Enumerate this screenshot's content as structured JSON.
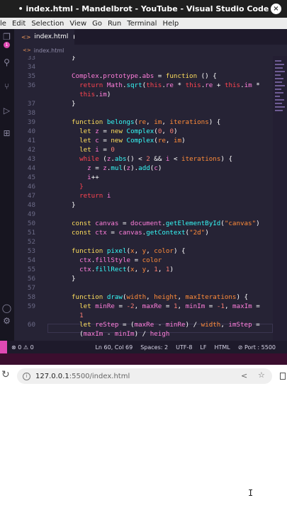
{
  "window": {
    "title": "• index.html - Mandelbrot - YouTube - Visual Studio Code",
    "close_glyph": "×"
  },
  "menu": [
    "le",
    "Edit",
    "Selection",
    "View",
    "Go",
    "Run",
    "Terminal",
    "Help"
  ],
  "activity": {
    "badge": "1"
  },
  "tab": {
    "label": "index.html"
  },
  "breadcrumb": {
    "file": "index.html"
  },
  "code_lines": [
    {
      "n": "33",
      "t": [
        [
          "w",
          "}"
        ]
      ]
    },
    {
      "n": "34",
      "t": []
    },
    {
      "n": "35",
      "t": [
        [
          "c",
          "Complex"
        ],
        [
          "w",
          "."
        ],
        [
          "c",
          "prototype"
        ],
        [
          "w",
          "."
        ],
        [
          "c",
          "abs"
        ],
        [
          "w",
          " = "
        ],
        [
          "k",
          "function"
        ],
        [
          "w",
          " () {"
        ]
      ]
    },
    {
      "n": "36",
      "t": [
        [
          "w",
          "  "
        ],
        [
          "p",
          "return"
        ],
        [
          "w",
          " "
        ],
        [
          "c",
          "Math"
        ],
        [
          "w",
          "."
        ],
        [
          "f",
          "sqrt"
        ],
        [
          "w",
          "("
        ],
        [
          "p",
          "this"
        ],
        [
          "w",
          "."
        ],
        [
          "c",
          "re"
        ],
        [
          "w",
          " * "
        ],
        [
          "p",
          "this"
        ],
        [
          "w",
          "."
        ],
        [
          "c",
          "re"
        ],
        [
          "w",
          " + "
        ],
        [
          "p",
          "this"
        ],
        [
          "w",
          "."
        ],
        [
          "c",
          "im"
        ],
        [
          "w",
          " *"
        ]
      ]
    },
    {
      "n": "",
      "t": [
        [
          "w",
          "  "
        ],
        [
          "p",
          "this"
        ],
        [
          "w",
          "."
        ],
        [
          "c",
          "im"
        ],
        [
          "w",
          ")"
        ]
      ]
    },
    {
      "n": "37",
      "t": [
        [
          "w",
          "}"
        ]
      ]
    },
    {
      "n": "38",
      "t": []
    },
    {
      "n": "39",
      "t": [
        [
          "k",
          "function"
        ],
        [
          "w",
          " "
        ],
        [
          "f",
          "belongs"
        ],
        [
          "w",
          "("
        ],
        [
          "s",
          "re"
        ],
        [
          "w",
          ", "
        ],
        [
          "s",
          "im"
        ],
        [
          "w",
          ", "
        ],
        [
          "s",
          "iterations"
        ],
        [
          "w",
          ") {"
        ]
      ]
    },
    {
      "n": "40",
      "t": [
        [
          "w",
          "  "
        ],
        [
          "k",
          "let"
        ],
        [
          "w",
          " "
        ],
        [
          "c",
          "z"
        ],
        [
          "w",
          " = "
        ],
        [
          "k",
          "new"
        ],
        [
          "w",
          " "
        ],
        [
          "f",
          "Complex"
        ],
        [
          "w",
          "("
        ],
        [
          "n",
          "0"
        ],
        [
          "w",
          ", "
        ],
        [
          "n",
          "0"
        ],
        [
          "w",
          ")"
        ]
      ]
    },
    {
      "n": "41",
      "t": [
        [
          "w",
          "  "
        ],
        [
          "k",
          "let"
        ],
        [
          "w",
          " "
        ],
        [
          "c",
          "c"
        ],
        [
          "w",
          " = "
        ],
        [
          "k",
          "new"
        ],
        [
          "w",
          " "
        ],
        [
          "f",
          "Complex"
        ],
        [
          "w",
          "("
        ],
        [
          "s",
          "re"
        ],
        [
          "w",
          ", "
        ],
        [
          "s",
          "im"
        ],
        [
          "w",
          ")"
        ]
      ]
    },
    {
      "n": "42",
      "t": [
        [
          "w",
          "  "
        ],
        [
          "k",
          "let"
        ],
        [
          "w",
          " "
        ],
        [
          "c",
          "i"
        ],
        [
          "w",
          " = "
        ],
        [
          "n",
          "0"
        ]
      ]
    },
    {
      "n": "43",
      "t": [
        [
          "w",
          "  "
        ],
        [
          "p",
          "while"
        ],
        [
          "w",
          " ("
        ],
        [
          "c",
          "z"
        ],
        [
          "w",
          "."
        ],
        [
          "f",
          "abs"
        ],
        [
          "w",
          "() < "
        ],
        [
          "n",
          "2"
        ],
        [
          "w",
          " && "
        ],
        [
          "c",
          "i"
        ],
        [
          "w",
          " < "
        ],
        [
          "s",
          "iterations"
        ],
        [
          "w",
          ") {"
        ]
      ]
    },
    {
      "n": "44",
      "t": [
        [
          "w",
          "    "
        ],
        [
          "c",
          "z"
        ],
        [
          "w",
          " = "
        ],
        [
          "c",
          "z"
        ],
        [
          "w",
          "."
        ],
        [
          "f",
          "mul"
        ],
        [
          "w",
          "("
        ],
        [
          "c",
          "z"
        ],
        [
          "w",
          ")."
        ],
        [
          "f",
          "add"
        ],
        [
          "w",
          "("
        ],
        [
          "c",
          "c"
        ],
        [
          "w",
          ")"
        ]
      ]
    },
    {
      "n": "45",
      "t": [
        [
          "w",
          "    "
        ],
        [
          "c",
          "i"
        ],
        [
          "w",
          "++"
        ]
      ]
    },
    {
      "n": "46",
      "t": [
        [
          "w",
          "  "
        ],
        [
          "p",
          "}"
        ]
      ]
    },
    {
      "n": "47",
      "t": [
        [
          "w",
          "  "
        ],
        [
          "p",
          "return"
        ],
        [
          "w",
          " "
        ],
        [
          "c",
          "i"
        ]
      ]
    },
    {
      "n": "48",
      "t": [
        [
          "w",
          "}"
        ]
      ]
    },
    {
      "n": "49",
      "t": []
    },
    {
      "n": "50",
      "t": [
        [
          "k",
          "const"
        ],
        [
          "w",
          " "
        ],
        [
          "c",
          "canvas"
        ],
        [
          "w",
          " = "
        ],
        [
          "c",
          "document"
        ],
        [
          "w",
          "."
        ],
        [
          "f",
          "getElementById"
        ],
        [
          "w",
          "("
        ],
        [
          "s",
          "\"canvas\""
        ],
        [
          "w",
          ")"
        ]
      ]
    },
    {
      "n": "51",
      "t": [
        [
          "k",
          "const"
        ],
        [
          "w",
          " "
        ],
        [
          "c",
          "ctx"
        ],
        [
          "w",
          " = "
        ],
        [
          "c",
          "canvas"
        ],
        [
          "w",
          "."
        ],
        [
          "f",
          "getContext"
        ],
        [
          "w",
          "("
        ],
        [
          "s",
          "\"2d\""
        ],
        [
          "w",
          ")"
        ]
      ]
    },
    {
      "n": "52",
      "t": []
    },
    {
      "n": "53",
      "t": [
        [
          "k",
          "function"
        ],
        [
          "w",
          " "
        ],
        [
          "f",
          "pixel"
        ],
        [
          "w",
          "("
        ],
        [
          "s",
          "x"
        ],
        [
          "w",
          ", "
        ],
        [
          "s",
          "y"
        ],
        [
          "w",
          ", "
        ],
        [
          "s",
          "color"
        ],
        [
          "w",
          ") {"
        ]
      ]
    },
    {
      "n": "54",
      "t": [
        [
          "w",
          "  "
        ],
        [
          "c",
          "ctx"
        ],
        [
          "w",
          "."
        ],
        [
          "c",
          "fillStyle"
        ],
        [
          "w",
          " = "
        ],
        [
          "s",
          "color"
        ]
      ]
    },
    {
      "n": "55",
      "t": [
        [
          "w",
          "  "
        ],
        [
          "c",
          "ctx"
        ],
        [
          "w",
          "."
        ],
        [
          "f",
          "fillRect"
        ],
        [
          "w",
          "("
        ],
        [
          "s",
          "x"
        ],
        [
          "w",
          ", "
        ],
        [
          "s",
          "y"
        ],
        [
          "w",
          ", "
        ],
        [
          "n",
          "1"
        ],
        [
          "w",
          ", "
        ],
        [
          "n",
          "1"
        ],
        [
          "w",
          ")"
        ]
      ]
    },
    {
      "n": "56",
      "t": [
        [
          "w",
          "}"
        ]
      ]
    },
    {
      "n": "57",
      "t": []
    },
    {
      "n": "58",
      "t": [
        [
          "k",
          "function"
        ],
        [
          "w",
          " "
        ],
        [
          "f",
          "draw"
        ],
        [
          "w",
          "("
        ],
        [
          "s",
          "width"
        ],
        [
          "w",
          ", "
        ],
        [
          "s",
          "height"
        ],
        [
          "w",
          ", "
        ],
        [
          "s",
          "maxIterations"
        ],
        [
          "w",
          ") {"
        ]
      ]
    },
    {
      "n": "59",
      "t": [
        [
          "w",
          "  "
        ],
        [
          "k",
          "let"
        ],
        [
          "w",
          " "
        ],
        [
          "c",
          "minRe"
        ],
        [
          "w",
          " = "
        ],
        [
          "n",
          "-2"
        ],
        [
          "w",
          ", "
        ],
        [
          "c",
          "maxRe"
        ],
        [
          "w",
          " = "
        ],
        [
          "n",
          "1"
        ],
        [
          "w",
          ", "
        ],
        [
          "c",
          "minIm"
        ],
        [
          "w",
          " = "
        ],
        [
          "n",
          "-1"
        ],
        [
          "w",
          ", "
        ],
        [
          "c",
          "maxIm"
        ],
        [
          "w",
          " ="
        ]
      ]
    },
    {
      "n": "",
      "t": [
        [
          "w",
          "  "
        ],
        [
          "n",
          "1"
        ]
      ]
    },
    {
      "n": "60",
      "t": [
        [
          "w",
          "  "
        ],
        [
          "k",
          "let"
        ],
        [
          "w",
          " "
        ],
        [
          "c",
          "reStep"
        ],
        [
          "w",
          " = ("
        ],
        [
          "c",
          "maxRe"
        ],
        [
          "w",
          " - "
        ],
        [
          "c",
          "minRe"
        ],
        [
          "w",
          ") / "
        ],
        [
          "s",
          "width"
        ],
        [
          "w",
          ", "
        ],
        [
          "c",
          "imStep"
        ],
        [
          "w",
          " ="
        ]
      ]
    },
    {
      "n": "",
      "t": [
        [
          "w",
          "  ("
        ],
        [
          "c",
          "maxIm"
        ],
        [
          "w",
          " - "
        ],
        [
          "c",
          "minIm"
        ],
        [
          "w",
          ") / "
        ],
        [
          "c",
          "heigh"
        ]
      ]
    }
  ],
  "status": {
    "problems": "⊗ 0 ⚠ 0",
    "position": "Ln 60, Col 69",
    "spaces": "Spaces: 2",
    "encoding": "UTF-8",
    "eol": "LF",
    "language": "HTML",
    "port": "⊘ Port : 5500"
  },
  "browser": {
    "host": "127.0.0.1",
    "path": ":5500/index.html"
  },
  "colors": {
    "editor_bg": "#262335",
    "keyword": "#fede5d",
    "control": "#fe4450",
    "function": "#36f9f6",
    "identifier": "#ff7edb",
    "string": "#ff8b39",
    "number": "#f97e72",
    "badge": "#e04ab4"
  }
}
